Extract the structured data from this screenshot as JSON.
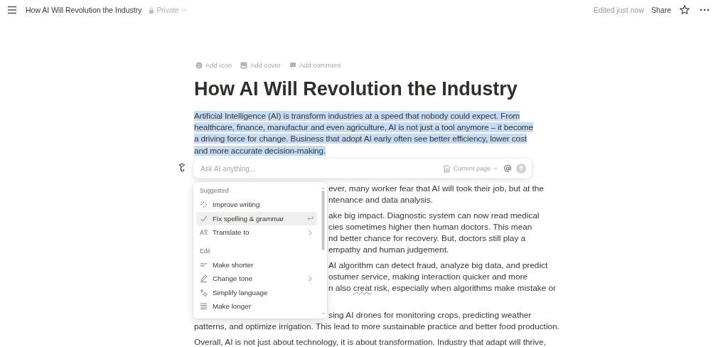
{
  "topbar": {
    "title": "How AI Will Revolution the Industry",
    "privacy": "Private",
    "edited": "Edited just now",
    "share": "Share"
  },
  "page_actions": [
    {
      "kind": "icon",
      "label": "Add icon"
    },
    {
      "kind": "cover",
      "label": "Add cover"
    },
    {
      "kind": "comment",
      "label": "Add comment"
    }
  ],
  "heading": "How AI Will Revolution the Industry",
  "intro": {
    "text": "Artificial Intelligence (AI) is transform industries at a speed that nobody could expect. From healthcare, finance, manufactur and even agriculture, AI is not just a tool anymore – it become a driving force for change. Business that adopt AI early often see better efficiency, lower cost and more accurate decision-making.",
    "selected": true
  },
  "ai_bar": {
    "placeholder": "Ask AI anything...",
    "context": "Current page"
  },
  "ai_menu": {
    "sections": [
      {
        "title": "Suggested",
        "items": [
          {
            "label": "Improve writing",
            "selected": false,
            "submenu": false
          },
          {
            "label": "Fix spelling & grammar",
            "selected": true,
            "submenu": false
          },
          {
            "label": "Translate to",
            "selected": false,
            "submenu": true
          }
        ]
      },
      {
        "title": "Edit",
        "items": [
          {
            "label": "Make shorter",
            "selected": false,
            "submenu": false
          },
          {
            "label": "Change tone",
            "selected": false,
            "submenu": true
          },
          {
            "label": "Simplify language",
            "selected": false,
            "submenu": false
          },
          {
            "label": "Make longer",
            "selected": false,
            "submenu": false
          }
        ]
      }
    ]
  },
  "paragraphs": [
    {
      "lines": [
        {
          "covered": true,
          "spans": [
            {
              "text": "ever, many worker fear that AI will took their job, but at the"
            }
          ]
        },
        {
          "covered": true,
          "spans": [
            {
              "text": "ntenance and data analysis."
            }
          ]
        }
      ]
    },
    {
      "lines": [
        {
          "covered": true,
          "spans": [
            {
              "text": "ake big impact. Diagnostic system can now read medical"
            }
          ]
        },
        {
          "covered": true,
          "spans": [
            {
              "text": "cies sometimes higher then human doctors. This mean"
            }
          ]
        },
        {
          "covered": true,
          "spans": [
            {
              "text": "nd better chance for recovery. But, doctors still play a"
            }
          ]
        },
        {
          "covered": true,
          "spans": [
            {
              "text": "empathy and human judgement."
            }
          ]
        }
      ]
    },
    {
      "lines": [
        {
          "covered": true,
          "spans": [
            {
              "text": "AI algorithm can detect fraud, analyze big data, and predict"
            }
          ]
        },
        {
          "covered": true,
          "spans": [
            {
              "text": "ostumer service, making interaction quicker and more"
            }
          ]
        },
        {
          "covered": true,
          "spans": [
            {
              "text": "n also "
            },
            {
              "text": "creat",
              "misspelled": true
            },
            {
              "text": " risk, especially when algorithms make mistake or"
            }
          ]
        }
      ]
    },
    {
      "lines": [
        {
          "covered": true,
          "spans": [
            {
              "text": "sing AI drones for monitoring crops, predicting weather"
            }
          ]
        },
        {
          "covered": false,
          "spans": [
            {
              "text": "patterns, and optimize irrigation. This lead to more sustainable practice and better food production."
            }
          ]
        }
      ]
    },
    {
      "lines": [
        {
          "covered": false,
          "spans": [
            {
              "text": "Overall, AI is not just about technology, it is about transformation. Industry that adapt will thrive,"
            }
          ]
        }
      ]
    }
  ]
}
